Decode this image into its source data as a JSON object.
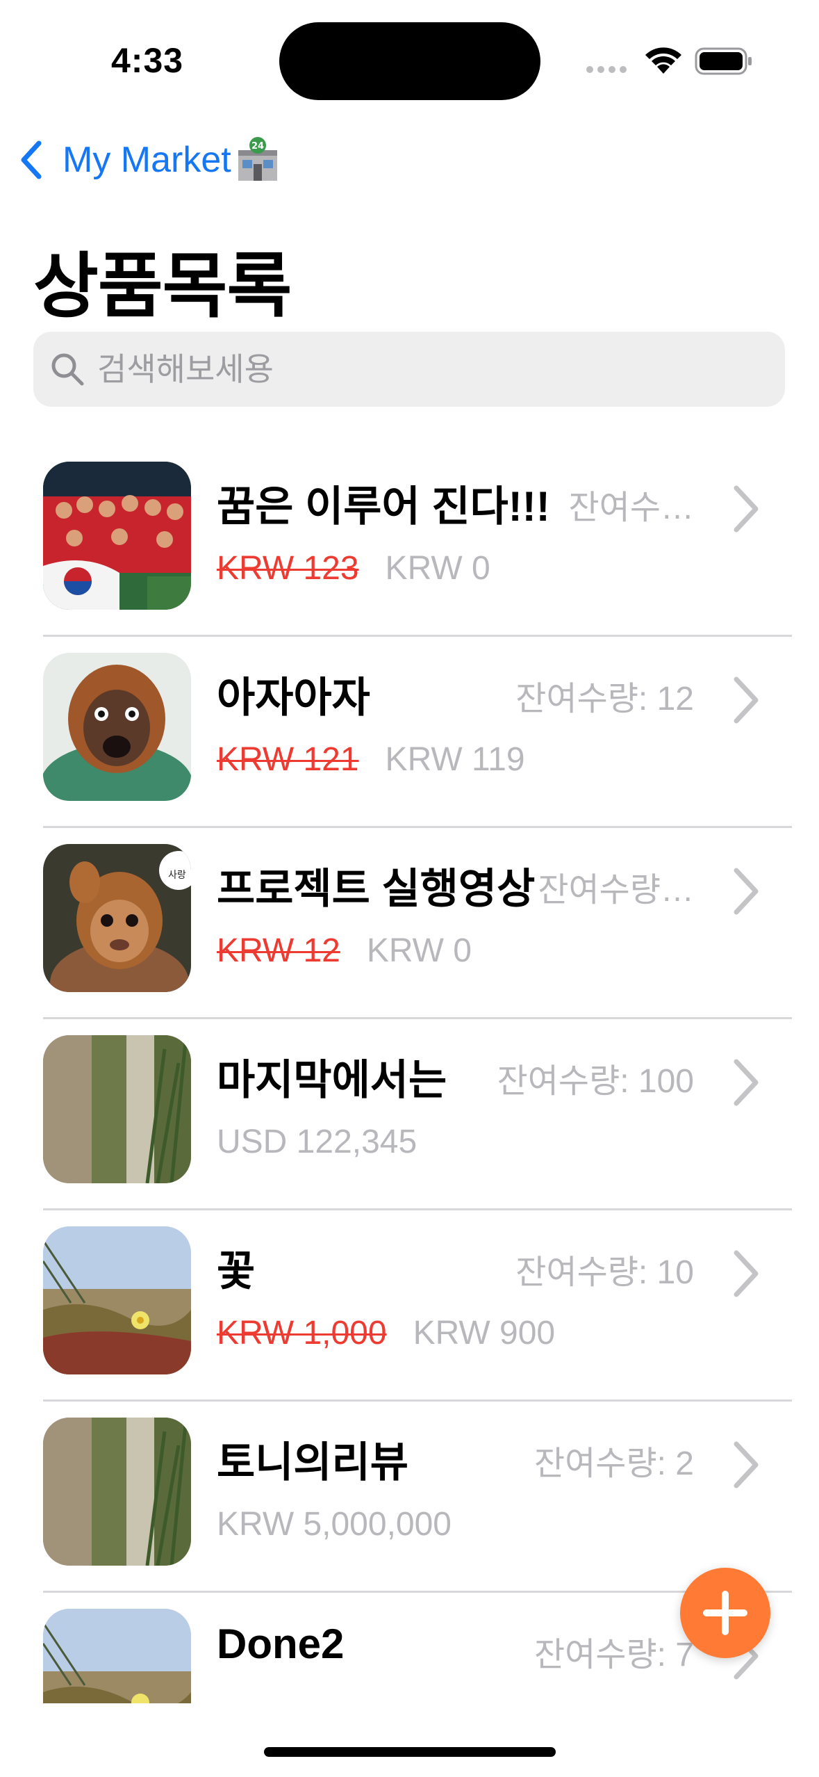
{
  "status_bar": {
    "time": "4:33"
  },
  "nav": {
    "back_label": "My Market",
    "market_icon": "convenience-store-24-icon"
  },
  "page": {
    "title": "상품목록"
  },
  "search": {
    "placeholder": "검색해보세용",
    "value": ""
  },
  "products": [
    {
      "name": "꿈은 이루어 진다!!!",
      "stock": "잔여수…",
      "original_price": "KRW 123",
      "price": "KRW 0",
      "thumb": "soccer-team-photo"
    },
    {
      "name": "아자아자",
      "stock": "잔여수량: 12",
      "original_price": "KRW 121",
      "price": "KRW 119",
      "thumb": "orangutan-shouting-photo"
    },
    {
      "name": "프로젝트 실행영상",
      "stock": "잔여수량…",
      "original_price": "KRW 12",
      "price": "KRW 0",
      "thumb": "orangutan-thumbs-photo",
      "thumb_caption": "사랑"
    },
    {
      "name": "마지막에서는",
      "stock": "잔여수량: 100",
      "original_price": "",
      "price": "USD 122,345",
      "thumb": "blurred-grass-photo"
    },
    {
      "name": "꽃",
      "stock": "잔여수량: 10",
      "original_price": "KRW 1,000",
      "price": "KRW 900",
      "thumb": "beach-flowers-photo"
    },
    {
      "name": "토니의리뷰",
      "stock": "잔여수량: 2",
      "original_price": "",
      "price": "KRW 5,000,000",
      "thumb": "blurred-grass-photo"
    },
    {
      "name": "Done2",
      "stock": "잔여수량: 7",
      "original_price": "",
      "price": "",
      "thumb": "beach-flowers-photo"
    }
  ],
  "colors": {
    "accent": "#1677f5",
    "fab": "#ff7a35",
    "strike": "#ee3b32",
    "muted": "#b8b8bc"
  }
}
